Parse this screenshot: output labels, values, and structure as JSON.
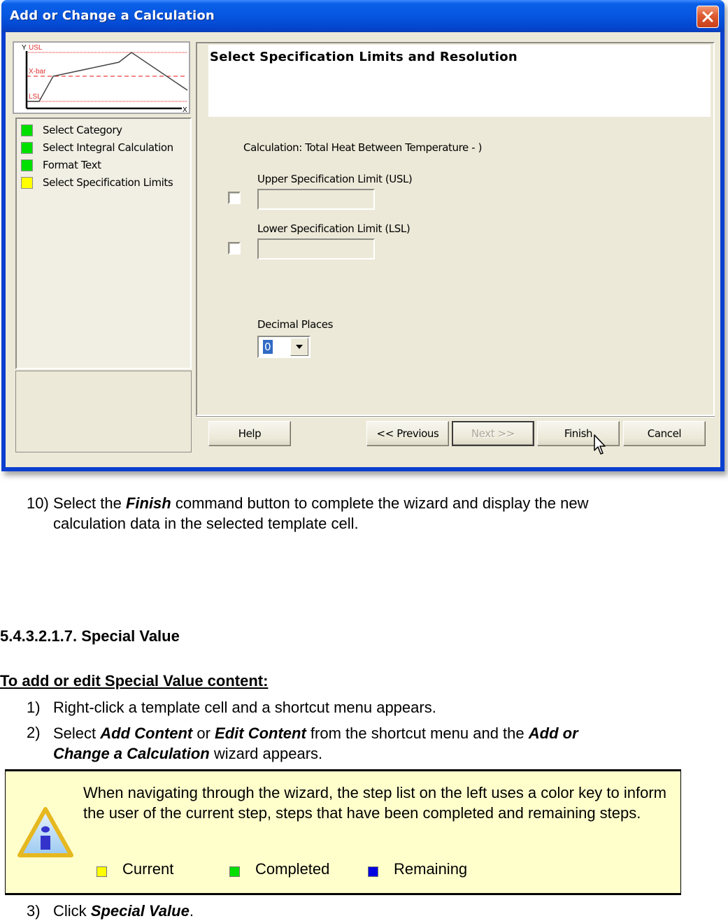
{
  "dialog": {
    "title": "Add or Change a Calculation",
    "preview_chart": {
      "axis_y_label": "Y",
      "axis_x_label": "X",
      "usl_label": "USL",
      "xbar_label": "X-bar",
      "lsl_label": "LSL"
    },
    "steps": [
      {
        "label": "Select Category",
        "status": "completed",
        "color": "#00e000"
      },
      {
        "label": "Select Integral Calculation",
        "status": "completed",
        "color": "#00e000"
      },
      {
        "label": "Format Text",
        "status": "completed",
        "color": "#00e000"
      },
      {
        "label": "Select Specification Limits",
        "status": "current",
        "color": "#ffff00"
      }
    ],
    "header_title": "Select Specification Limits and Resolution",
    "calculation_label": "Calculation: Total Heat Between Temperature - )",
    "usl": {
      "label": "Upper Specification Limit (USL)",
      "checked": false,
      "value": ""
    },
    "lsl": {
      "label": "Lower Specification Limit (LSL)",
      "checked": false,
      "value": ""
    },
    "decimal_places": {
      "label": "Decimal Places",
      "value": "0"
    },
    "buttons": {
      "help": "Help",
      "previous": "<< Previous",
      "next": "Next >>",
      "finish": "Finish",
      "cancel": "Cancel"
    }
  },
  "document": {
    "step10": {
      "number": "10)",
      "text_before": "Select the ",
      "bold": "Finish",
      "text_after": " command button to complete the wizard and display the new",
      "line2": "calculation data in the selected template cell."
    },
    "section_heading": "5.4.3.2.1.7. Special Value",
    "subheading": "To add or edit Special Value content:",
    "steps": [
      {
        "number": "1)",
        "text": "Right-click a template cell and a shortcut menu appears."
      },
      {
        "number": "2)",
        "pre": "Select ",
        "b1": "Add Content",
        "mid": " or ",
        "b2": "Edit Content",
        "post": " from the shortcut menu and the ",
        "b3": "Add or",
        "line2_b": "Change a Calculation",
        "line2_post": " wizard appears."
      },
      {
        "number": "3)",
        "pre": "Click ",
        "bold": "Special Value",
        "post": "."
      }
    ],
    "note": {
      "text": "When navigating through the wizard, the step list on the left uses a color key to inform the user of the current step, steps that have been completed and remaining steps.",
      "legend": [
        {
          "label": "Current",
          "color": "#ffff00"
        },
        {
          "label": "Completed",
          "color": "#00e000"
        },
        {
          "label": "Remaining",
          "color": "#0000e0"
        }
      ]
    }
  }
}
